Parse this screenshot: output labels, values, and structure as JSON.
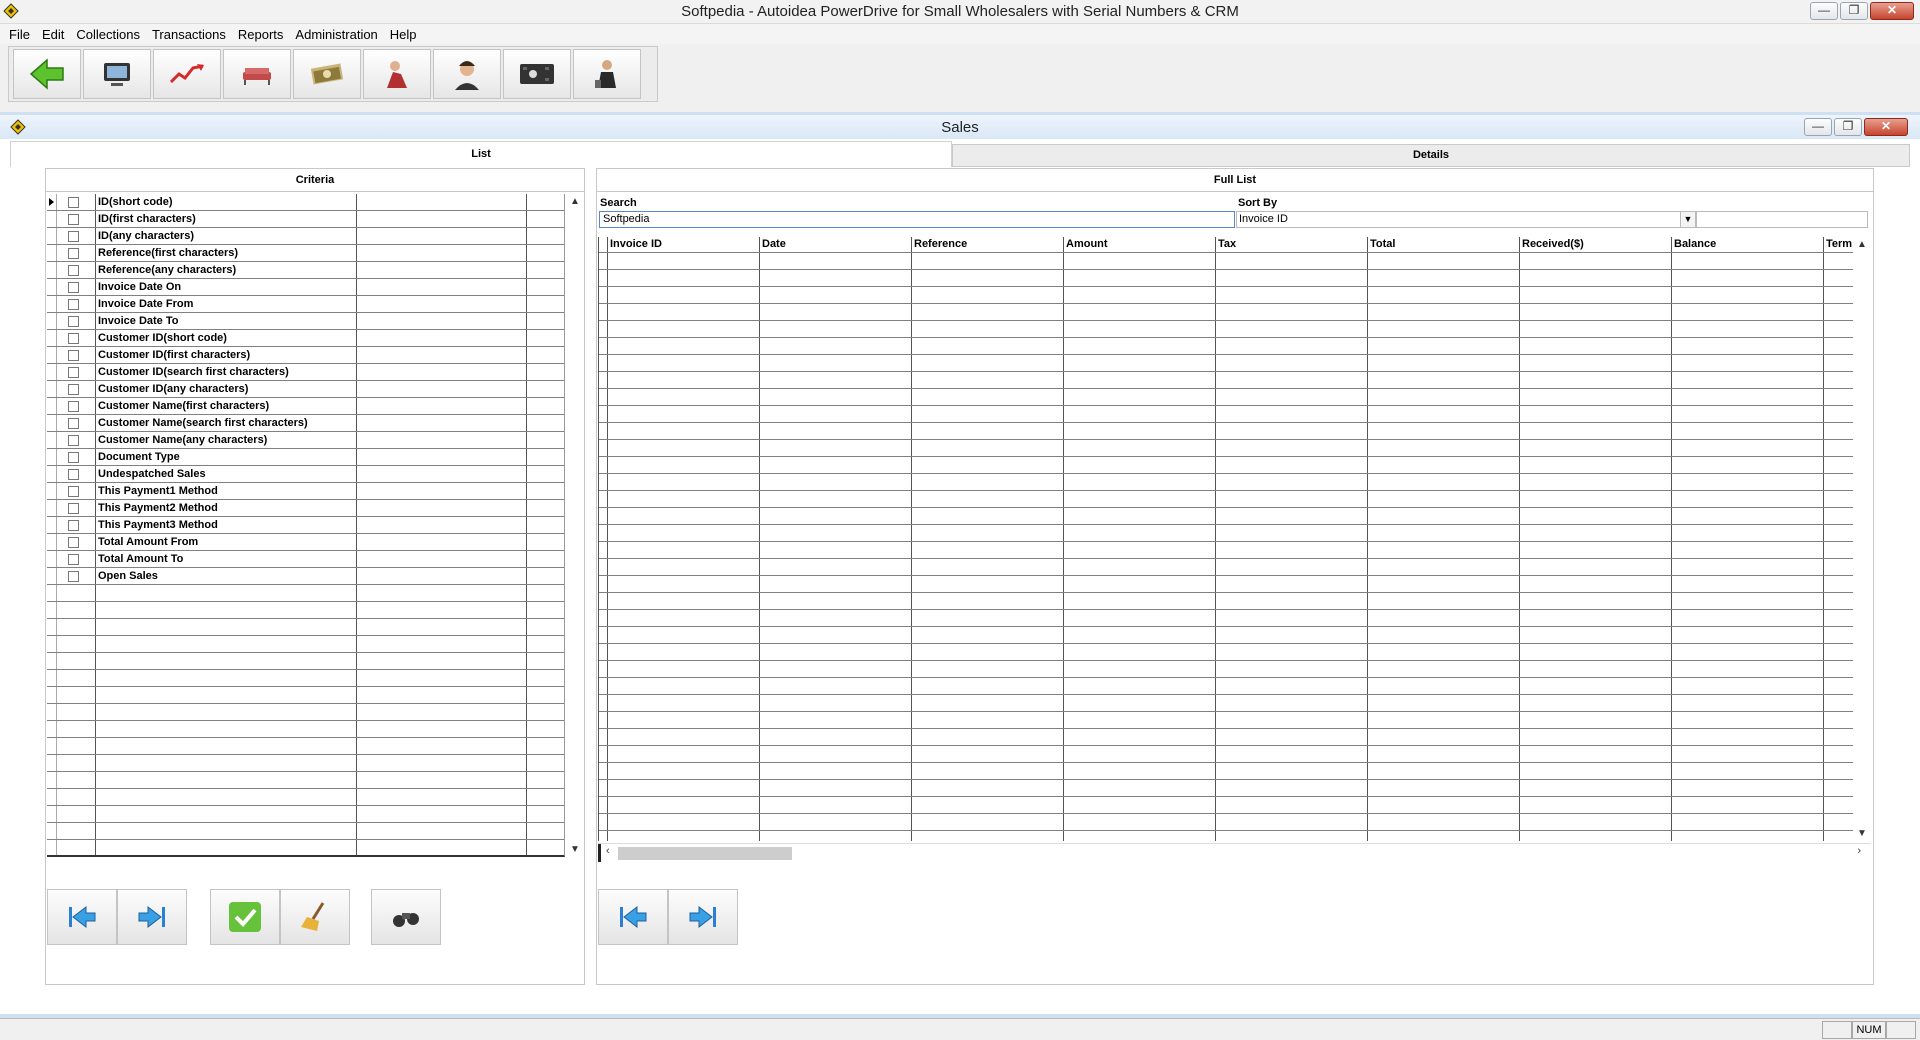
{
  "window": {
    "title": "Softpedia - Autoidea PowerDrive for Small Wholesalers with Serial Numbers & CRM",
    "min": "—",
    "max": "❐",
    "close": "✕"
  },
  "menu": [
    "File",
    "Edit",
    "Collections",
    "Transactions",
    "Reports",
    "Administration",
    "Help"
  ],
  "toolbar": {
    "buttons": [
      "back-arrow-icon",
      "monitor-icon",
      "chart-icon",
      "sofa-icon",
      "money-icon",
      "person-icon",
      "support-agent-icon",
      "keyboard-icon",
      "businessman-icon"
    ]
  },
  "document": {
    "title": "Sales",
    "tabs": {
      "list": "List",
      "details": "Details"
    }
  },
  "criteria": {
    "header": "Criteria",
    "rows": [
      "ID(short code)",
      "ID(first characters)",
      "ID(any characters)",
      "Reference(first characters)",
      "Reference(any characters)",
      "Invoice Date On",
      "Invoice Date From",
      "Invoice Date To",
      "Customer ID(short code)",
      "Customer ID(first characters)",
      "Customer ID(search first characters)",
      "Customer ID(any characters)",
      "Customer Name(first characters)",
      "Customer Name(search first characters)",
      "Customer Name(any characters)",
      "Document Type",
      "Undespatched Sales",
      "This Payment1 Method",
      "This Payment2 Method",
      "This Payment3 Method",
      "Total Amount From",
      "Total Amount To",
      "Open Sales"
    ]
  },
  "fulllist": {
    "header": "Full List",
    "search_label": "Search",
    "search_value": "Softpedia",
    "sort_label": "Sort By",
    "sort_value": "Invoice ID",
    "columns": [
      "Invoice ID",
      "Date",
      "Reference",
      "Amount",
      "Tax",
      "Total",
      "Received($)",
      "Balance",
      "Term"
    ]
  },
  "statusbar": {
    "num": "NUM"
  },
  "colors": {
    "accent": "#cfe0f2",
    "close": "#c7442e"
  }
}
